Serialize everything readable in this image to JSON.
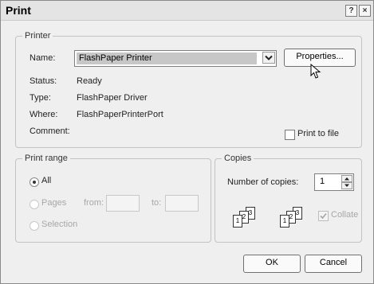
{
  "dialog": {
    "title": "Print",
    "help_glyph": "?",
    "close_glyph": "×"
  },
  "printer": {
    "legend": "Printer",
    "name_label": "Name:",
    "name_value": "FlashPaper Printer",
    "properties_button": "Properties...",
    "status_label": "Status:",
    "status_value": "Ready",
    "type_label": "Type:",
    "type_value": "FlashPaper Driver",
    "where_label": "Where:",
    "where_value": "FlashPaperPrinterPort",
    "comment_label": "Comment:",
    "print_to_file": "Print to file"
  },
  "print_range": {
    "legend": "Print range",
    "all": "All",
    "pages": "Pages",
    "from": "from:",
    "to": "to:",
    "selection": "Selection"
  },
  "copies": {
    "legend": "Copies",
    "number_label": "Number of copies:",
    "number_value": "1",
    "collate": "Collate",
    "page_labels": [
      "1",
      "2",
      "3"
    ]
  },
  "buttons": {
    "ok": "OK",
    "cancel": "Cancel"
  },
  "icons": {
    "dropdown": "chevron-down-icon",
    "cursor": "mouse-pointer-icon",
    "spin_up": "triangle-up-icon",
    "spin_down": "triangle-down-icon"
  }
}
